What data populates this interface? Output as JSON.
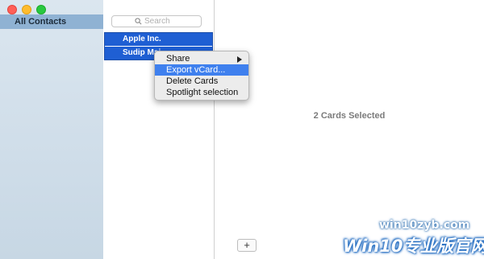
{
  "sidebar": {
    "items": [
      {
        "label": "All Contacts"
      }
    ]
  },
  "list": {
    "search_placeholder": "Search",
    "rows": [
      {
        "label": "Apple Inc."
      },
      {
        "label": "Sudip Maj"
      }
    ]
  },
  "context_menu": {
    "items": [
      {
        "label": "Share"
      },
      {
        "label": "Export vCard..."
      },
      {
        "label": "Delete Cards"
      },
      {
        "label": "Spotlight selection"
      }
    ],
    "active_item": "Export vCard..."
  },
  "detail": {
    "status": "2 Cards Selected",
    "add_button": "+"
  },
  "watermark": {
    "url": "win10zyb.com",
    "brand": "Win10专业版官网"
  },
  "colors": {
    "selection": "#1f5fd3",
    "menu_highlight": "#3f80ee",
    "sidebar_selected": "#8fb2d3"
  }
}
